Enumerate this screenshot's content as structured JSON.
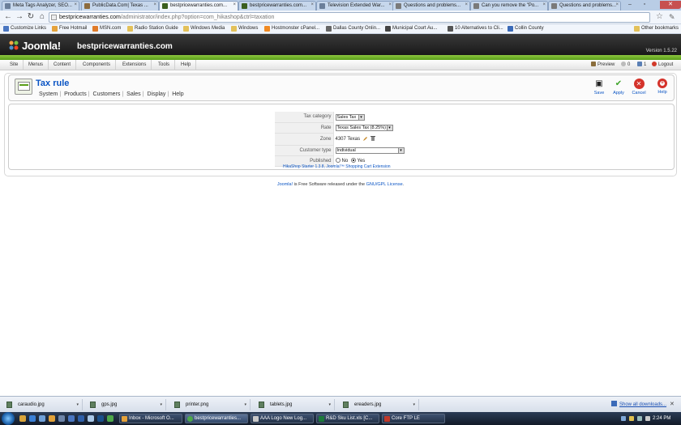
{
  "browser": {
    "tabs": [
      {
        "label": "Meta Tags Analyzer, SEO...",
        "color": "#6b7f9a"
      },
      {
        "label": "PublicData.Com| Texas ...",
        "color": "#8c6b3e"
      },
      {
        "label": "bestpricewarranties.com...",
        "color": "#3b5f1f",
        "active": true
      },
      {
        "label": "bestpricewarranties.com...",
        "color": "#3b5f1f"
      },
      {
        "label": "Television Extended War...",
        "color": "#6b7f9a"
      },
      {
        "label": "Questions and problems...",
        "color": "#7a7a7a"
      },
      {
        "label": "Can you remove the \"Po...",
        "color": "#7a7a7a"
      },
      {
        "label": "Questions and problems...",
        "color": "#7a7a7a"
      }
    ],
    "address": {
      "host": "bestpricewarranties.com",
      "path": "/administrator/index.php?option=com_hikashop&ctrl=taxation"
    },
    "bookmarks": [
      {
        "label": "Customize Links",
        "color": "#4a76c1"
      },
      {
        "label": "Free Hotmail",
        "color": "#e5a23b"
      },
      {
        "label": "MSN.com",
        "color": "#e07b2a"
      },
      {
        "label": "Radio Station Guide",
        "color": "#e3c15a"
      },
      {
        "label": "Windows Media",
        "color": "#e3c15a"
      },
      {
        "label": "Windows",
        "color": "#e3c15a"
      },
      {
        "label": "Hostmonster cPanel...",
        "color": "#f08a24"
      },
      {
        "label": "Dallas County Onlin...",
        "color": "#666666"
      },
      {
        "label": "Municipal Court Au...",
        "color": "#444444"
      },
      {
        "label": "10 Alternatives to Cli...",
        "color": "#555555"
      },
      {
        "label": "Collin County",
        "color": "#3a6ab8"
      }
    ],
    "other_bookmarks": "Other bookmarks"
  },
  "joomla": {
    "logo_text": "Joomla!",
    "site_name": "bestpricewarranties.com",
    "version": "Version 1.5.22",
    "menu": [
      "Site",
      "Menus",
      "Content",
      "Components",
      "Extensions",
      "Tools",
      "Help"
    ],
    "status": {
      "preview": "Preview",
      "messages": "0",
      "users": "1",
      "logout": "Logout"
    },
    "page_title": "Tax rule",
    "submenu": [
      "System",
      "Products",
      "Customers",
      "Sales",
      "Display",
      "Help"
    ],
    "toolbar": {
      "save": "Save",
      "apply": "Apply",
      "cancel": "Cancel",
      "help": "Help"
    },
    "form": {
      "tax_category_label": "Tax category",
      "tax_category_value": "Sales Tax",
      "rate_label": "Rate",
      "rate_value": "Texas Sales Tax (8.25%)",
      "zone_label": "Zone",
      "zone_value": "4307 Texas",
      "customer_type_label": "Customer type",
      "customer_type_value": "Individual",
      "published_label": "Published",
      "published_no": "No",
      "published_yes": "Yes",
      "published_value": "Yes"
    },
    "hika_credit": "HikaShop Starter 1.3.8, Joomla!™ Shopping Cart Extension",
    "footer": {
      "link1": "Joomla!",
      "middle": " is Free Software released under the ",
      "link2": "GNU/GPL License",
      "end": "."
    }
  },
  "downloads": {
    "items": [
      "caraudio.jpg",
      "gps.jpg",
      "printer.png",
      "tablets.jpg",
      "ereaders.jpg"
    ],
    "show_all": "Show all downloads..."
  },
  "taskbar": {
    "buttons": [
      {
        "label": "Inbox - Microsoft O...",
        "color": "#e5a23b"
      },
      {
        "label": "bestpricewarranties...",
        "color": "#4ea84a",
        "active": true
      },
      {
        "label": "AAA Logo New Log...",
        "color": "#c9c9c9"
      },
      {
        "label": "R&D Sku List.xls [C...",
        "color": "#1d7a3a"
      },
      {
        "label": "Core FTP LE",
        "color": "#c0392b"
      }
    ],
    "clock": "2:24 PM"
  }
}
